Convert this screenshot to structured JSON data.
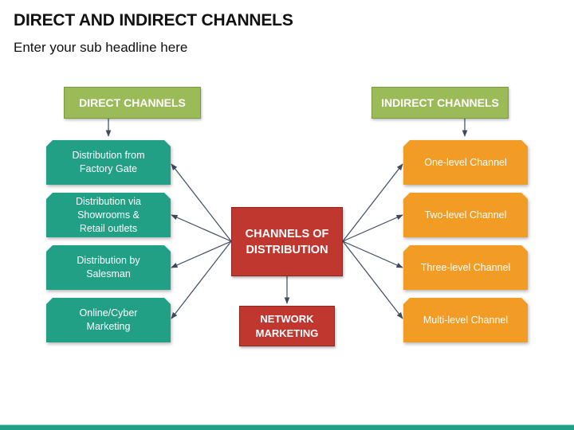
{
  "title": "DIRECT AND INDIRECT CHANNELS",
  "subtitle": "Enter your sub headline here",
  "direct": {
    "header": "DIRECT CHANNELS",
    "items": [
      "Distribution from\nFactory Gate",
      "Distribution via\nShowrooms &\nRetail outlets",
      "Distribution by\nSalesman",
      "Online/Cyber\nMarketing"
    ]
  },
  "indirect": {
    "header": "INDIRECT CHANNELS",
    "items": [
      "One-level Channel",
      "Two-level Channel",
      "Three-level Channel",
      "Multi-level Channel"
    ]
  },
  "center": {
    "main": "CHANNELS OF\nDISTRIBUTION",
    "network": "NETWORK\nMARKETING"
  },
  "colors": {
    "header_green": "#9bbb59",
    "direct_teal": "#21a085",
    "indirect_orange": "#f39c25",
    "center_red": "#c0372f",
    "arrow": "#3d4a60"
  }
}
